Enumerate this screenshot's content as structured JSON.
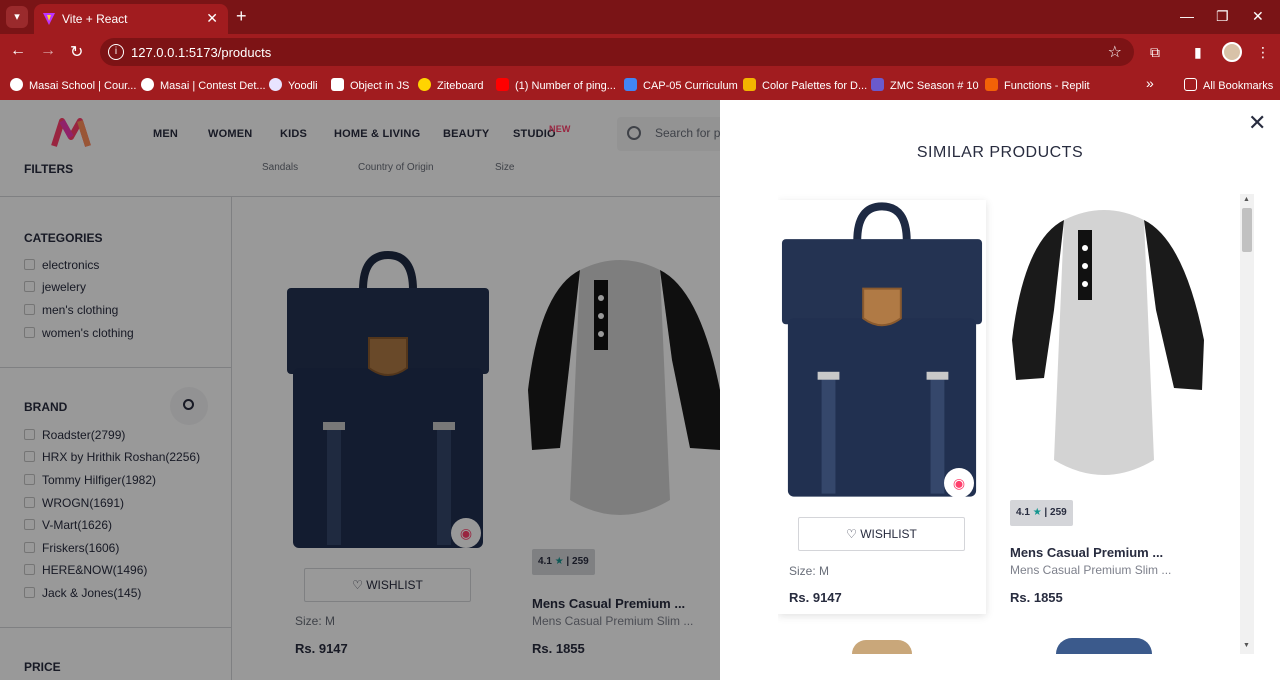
{
  "browser": {
    "tab_title": "Vite + React",
    "url": "127.0.0.1:5173/products",
    "bookmarks": [
      "Masai School | Cour...",
      "Masai | Contest Det...",
      "Yoodli",
      "Object in JS",
      "Ziteboard",
      "(1) Number of ping...",
      "CAP-05 Curriculum",
      "Color Palettes for D...",
      "ZMC Season # 10",
      "Functions - Replit"
    ],
    "more_bookmarks": "»",
    "all_bookmarks": "All Bookmarks"
  },
  "header": {
    "nav": [
      "MEN",
      "WOMEN",
      "KIDS",
      "HOME & LIVING",
      "BEAUTY",
      "STUDIO"
    ],
    "studio_badge": "NEW",
    "search_placeholder": "Search for products, brands and more"
  },
  "filters": {
    "title": "FILTERS",
    "subfilters": [
      "Sandals",
      "Country of Origin",
      "Size"
    ],
    "categories_title": "CATEGORIES",
    "categories": [
      "electronics",
      "jewelery",
      "men's clothing",
      "women's clothing"
    ],
    "brand_title": "BRAND",
    "brands": [
      "Roadster(2799)",
      "HRX by Hrithik Roshan(2256)",
      "Tommy Hilfiger(1982)",
      "WROGN(1691)",
      "V-Mart(1626)",
      "Friskers(1606)",
      "HERE&NOW(1496)",
      "Jack & Jones(145)"
    ],
    "price_title": "PRICE"
  },
  "products": [
    {
      "wishlist": "WISHLIST",
      "size": "Size: M",
      "price": "Rs. 9147"
    },
    {
      "rating": "4.1",
      "count": "259",
      "name": "Mens Casual Premium ...",
      "desc": "Mens Casual Premium Slim ...",
      "price": "Rs. 1855"
    }
  ],
  "drawer": {
    "title": "SIMILAR PRODUCTS",
    "close": "✕",
    "items": [
      {
        "wishlist": "WISHLIST",
        "size": "Size: M",
        "price": "Rs. 9147"
      },
      {
        "rating": "4.1",
        "count": "259",
        "name": "Mens Casual Premium ...",
        "desc": "Mens Casual Premium Slim ...",
        "price": "Rs. 1855"
      }
    ]
  },
  "colors": {
    "chrome": "#a11c1f",
    "chrome_dark": "#7a1416",
    "accent": "#ff3f6c",
    "rating_star": "#14958f"
  }
}
